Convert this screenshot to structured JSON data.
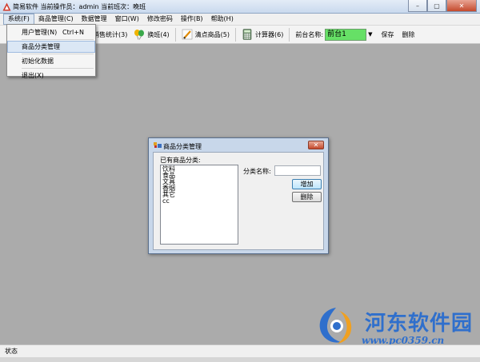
{
  "window": {
    "title": "简易软件 当前操作员：admin 当前班次：晚班"
  },
  "menubar": {
    "items": [
      "系统(F)",
      "商品管理(C)",
      "数据管理",
      "窗口(W)",
      "修改密码",
      "操作(B)",
      "帮助(H)"
    ]
  },
  "toolbar": {
    "stats_label": "销售统计(3)",
    "shift_label": "换班(4)",
    "inventory_label": "清点商品(5)",
    "calculator_label": "计算器(6)",
    "station_label": "前台名称:",
    "station_value": "前台1",
    "save_label": "保存",
    "delete_label": "删除"
  },
  "system_menu": {
    "user_mgmt": "用户管理(N)",
    "user_mgmt_shortcut": "Ctrl+N",
    "category_mgmt": "商品分类管理",
    "init_data": "初始化数据",
    "exit": "退出(X)"
  },
  "dialog": {
    "title": "商品分类管理",
    "existing_label": "已有商品分类:",
    "categories": [
      "饮料",
      "食品",
      "文具",
      "香烟",
      "其它",
      "cc"
    ],
    "name_label": "分类名称:",
    "name_value": "",
    "add_label": "增加",
    "delete_label": "删除"
  },
  "statusbar": {
    "text": "状态"
  },
  "watermark": {
    "name": "河东软件园",
    "url": "www.pc0359.cn"
  },
  "colors": {
    "desktop": "#ababab",
    "station_bg": "#66e066",
    "watermark": "#2f6fcc",
    "close_red": "#c4492c"
  }
}
